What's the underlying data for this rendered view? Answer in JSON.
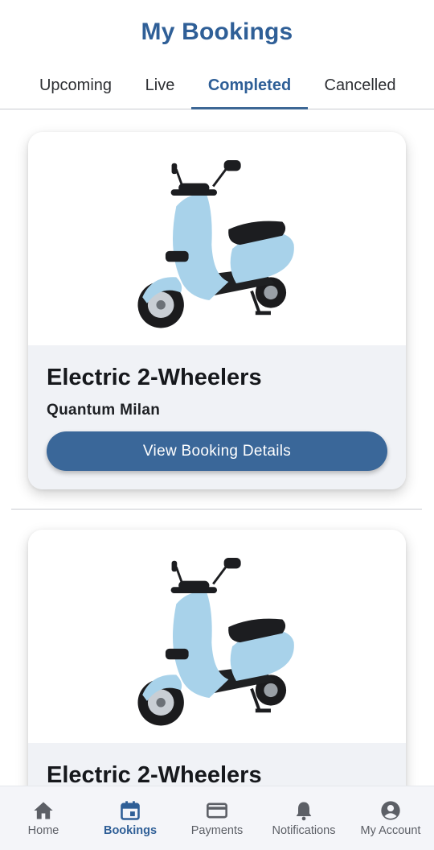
{
  "header": {
    "title": "My Bookings"
  },
  "tabs": [
    {
      "label": "Upcoming",
      "active": false
    },
    {
      "label": "Live",
      "active": false
    },
    {
      "label": "Completed",
      "active": true
    },
    {
      "label": "Cancelled",
      "active": false
    }
  ],
  "bookings": [
    {
      "category": "Electric 2-Wheelers",
      "model": "Quantum Milan",
      "button_label": "View Booking Details",
      "image_icon": "scooter-image"
    },
    {
      "category": "Electric 2-Wheelers",
      "model": "",
      "button_label": "",
      "image_icon": "scooter-image"
    }
  ],
  "bottom_nav": [
    {
      "label": "Home",
      "icon": "home-icon",
      "active": false
    },
    {
      "label": "Bookings",
      "icon": "calendar-icon",
      "active": true
    },
    {
      "label": "Payments",
      "icon": "card-icon",
      "active": false
    },
    {
      "label": "Notifications",
      "icon": "bell-icon",
      "active": false
    },
    {
      "label": "My Account",
      "icon": "account-icon",
      "active": false
    }
  ],
  "colors": {
    "primary": "#2f5f97",
    "button": "#3a6799",
    "card_body": "#f0f2f6",
    "scooter": "#a8d2ea"
  }
}
